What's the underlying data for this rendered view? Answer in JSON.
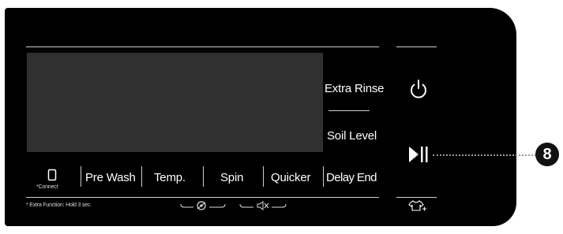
{
  "panel": {
    "options": {
      "extra_rinse": "Extra Rinse",
      "soil_level": "Soil Level"
    },
    "buttons": {
      "connect": "*Connect",
      "pre_wash": "Pre Wash",
      "temp": "Temp.",
      "spin": "Spin",
      "quicker": "Quicker",
      "delay_end": "Delay End"
    },
    "footnote": "* Extra Function: Hold 3 sec.",
    "icons": [
      "phone-icon",
      "power-icon",
      "start-pause-icon",
      "shirt-plus-icon",
      "drum-lock-icon",
      "mute-icon"
    ]
  },
  "callout": {
    "number": "8"
  },
  "colors": {
    "panel": "#000000",
    "screen": "#303030",
    "divider": "#cfcfcf"
  }
}
